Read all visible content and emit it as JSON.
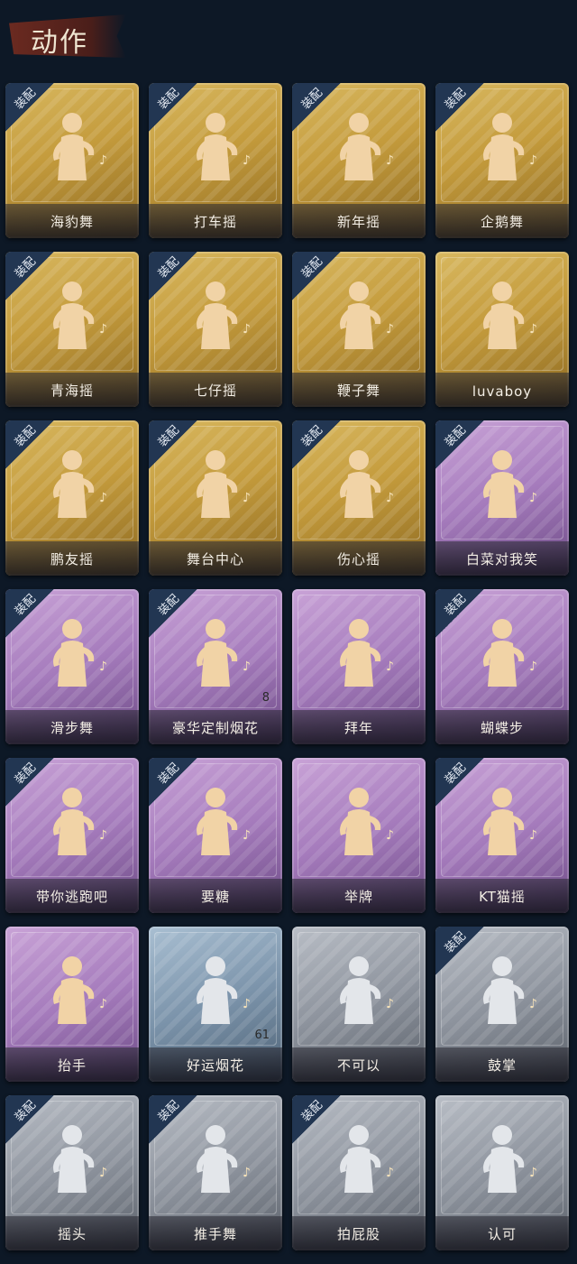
{
  "header": {
    "title": "动作"
  },
  "equip_label": "装配",
  "cards": [
    {
      "name": "海豹舞",
      "tier": "gold",
      "equipped": true,
      "count": ""
    },
    {
      "name": "打车摇",
      "tier": "gold",
      "equipped": true,
      "count": ""
    },
    {
      "name": "新年摇",
      "tier": "gold",
      "equipped": true,
      "count": ""
    },
    {
      "name": "企鹅舞",
      "tier": "gold",
      "equipped": true,
      "count": ""
    },
    {
      "name": "青海摇",
      "tier": "gold",
      "equipped": true,
      "count": ""
    },
    {
      "name": "七仔摇",
      "tier": "gold",
      "equipped": true,
      "count": ""
    },
    {
      "name": "鞭子舞",
      "tier": "gold",
      "equipped": true,
      "count": ""
    },
    {
      "name": "luvaboy",
      "tier": "gold",
      "equipped": false,
      "count": ""
    },
    {
      "name": "鹏友摇",
      "tier": "gold",
      "equipped": true,
      "count": ""
    },
    {
      "name": "舞台中心",
      "tier": "gold",
      "equipped": true,
      "count": ""
    },
    {
      "name": "伤心摇",
      "tier": "gold",
      "equipped": true,
      "count": ""
    },
    {
      "name": "白菜对我笑",
      "tier": "purple",
      "equipped": true,
      "count": ""
    },
    {
      "name": "滑步舞",
      "tier": "purple",
      "equipped": true,
      "count": ""
    },
    {
      "name": "豪华定制烟花",
      "tier": "purple",
      "equipped": true,
      "count": "8"
    },
    {
      "name": "拜年",
      "tier": "purple",
      "equipped": false,
      "count": ""
    },
    {
      "name": "蝴蝶步",
      "tier": "purple",
      "equipped": true,
      "count": ""
    },
    {
      "name": "带你逃跑吧",
      "tier": "purple",
      "equipped": true,
      "count": ""
    },
    {
      "name": "要糖",
      "tier": "purple",
      "equipped": true,
      "count": ""
    },
    {
      "name": "举牌",
      "tier": "purple",
      "equipped": false,
      "count": ""
    },
    {
      "name": "KT猫摇",
      "tier": "purple",
      "equipped": true,
      "count": ""
    },
    {
      "name": "抬手",
      "tier": "purple",
      "equipped": false,
      "count": ""
    },
    {
      "name": "好运烟花",
      "tier": "blue",
      "equipped": false,
      "count": "61"
    },
    {
      "name": "不可以",
      "tier": "silver",
      "equipped": false,
      "count": ""
    },
    {
      "name": "鼓掌",
      "tier": "silver",
      "equipped": true,
      "count": ""
    },
    {
      "name": "摇头",
      "tier": "silver",
      "equipped": true,
      "count": ""
    },
    {
      "name": "推手舞",
      "tier": "silver",
      "equipped": true,
      "count": ""
    },
    {
      "name": "拍屁股",
      "tier": "silver",
      "equipped": true,
      "count": ""
    },
    {
      "name": "认可",
      "tier": "silver",
      "equipped": false,
      "count": ""
    }
  ]
}
